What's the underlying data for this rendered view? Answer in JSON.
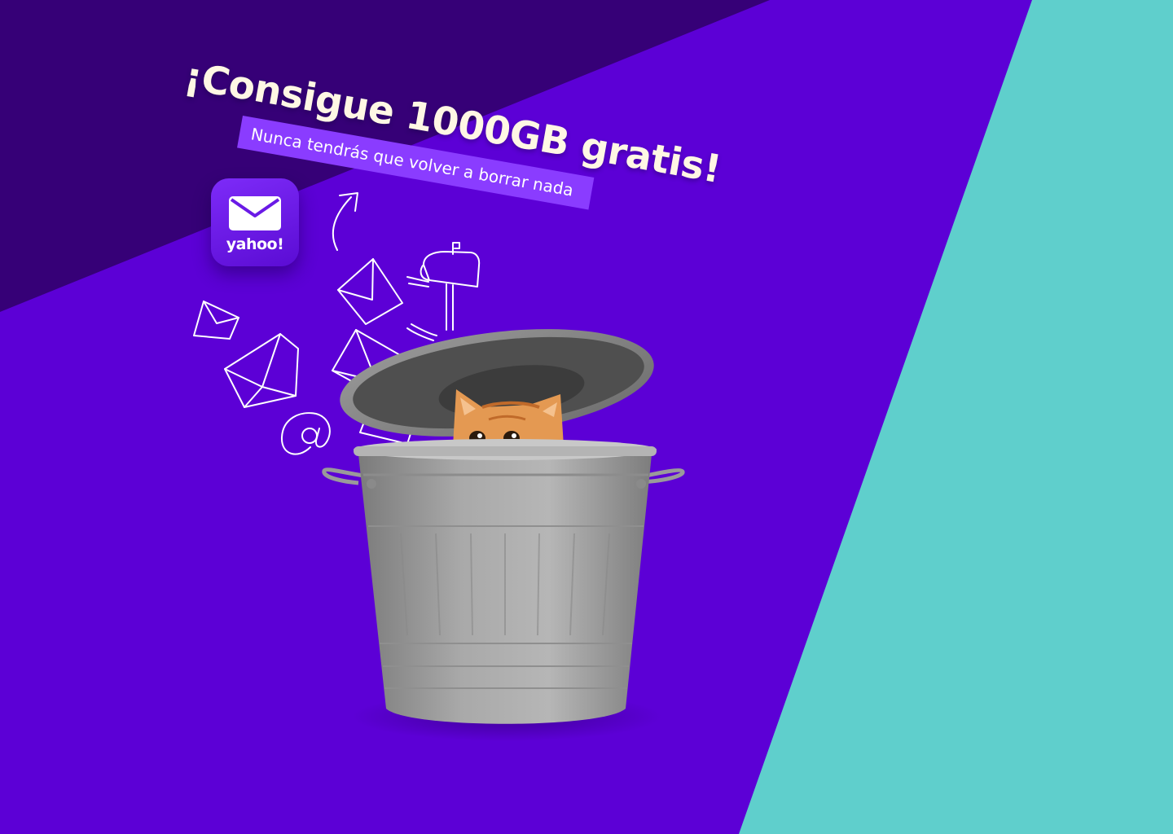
{
  "promo": {
    "headline": "¡Consigue 1000GB gratis!",
    "subheadline": "Nunca tendrás que volver a borrar nada"
  },
  "app_icon": {
    "brand": "yahoo!",
    "icon": "mail-envelope-icon"
  },
  "doodle_icons": [
    "arrow-icon",
    "envelope-icon",
    "mailbox-icon",
    "envelope-icon",
    "open-envelope-icon",
    "envelope-icon",
    "envelope-icon",
    "at-sign-icon"
  ],
  "illustration": "trash-bin-with-cat",
  "colors": {
    "background_purple": "#5c00d6",
    "dark_purple_panel": "#360077",
    "teal_panel": "#5fcfcc",
    "headline_text": "#fff7e4",
    "subheadline_ribbon": "#8a3cff",
    "icon_gradient_top": "#7d2bf8",
    "icon_gradient_bottom": "#5b0cd4"
  }
}
